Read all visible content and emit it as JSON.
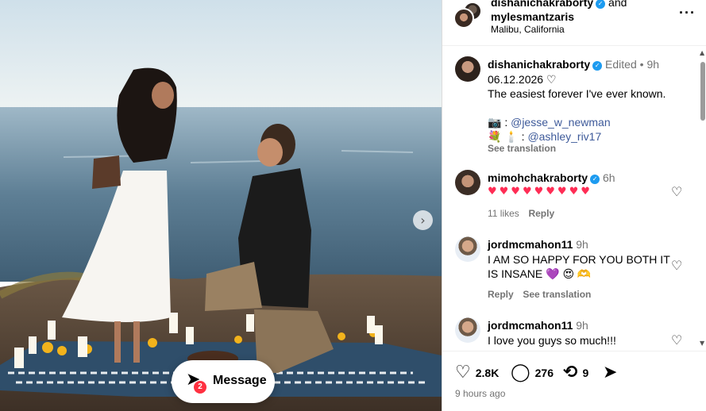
{
  "header": {
    "user1": "dishanichakraborty",
    "and": "and",
    "user2": "mylesmantzaris",
    "location": "Malibu, California"
  },
  "caption": {
    "username": "dishanichakraborty",
    "edited": "Edited",
    "time": "9h",
    "line1": "06.12.2026 ♡",
    "line2": "The easiest forever I've ever known.",
    "credit1_prefix": "📷 :",
    "credit1_handle": "@jesse_w_newman",
    "credit2_prefix": "💐 🕯️ :",
    "credit2_handle": "@ashley_riv17",
    "see_translation": "See translation"
  },
  "comments": [
    {
      "username": "mimohchakraborty",
      "time": "6h",
      "text": "♥♥♥♥♥♥♥♥♥",
      "likes": "11 likes",
      "reply": "Reply"
    },
    {
      "username": "jordmcmahon11",
      "time": "9h",
      "text_line1": "I AM SO HAPPY FOR YOU BOTH IT",
      "text_line2": "IS INSANE 💜 😍 🫶",
      "reply": "Reply",
      "see_translation": "See translation"
    },
    {
      "username": "jordmcmahon11",
      "time": "9h",
      "text": "I love you guys so much!!!"
    }
  ],
  "footer": {
    "likes": "2.8K",
    "comments": "276",
    "reposts": "9",
    "time_ago": "9 hours ago"
  },
  "messages": {
    "label": "Message",
    "badge": "2"
  },
  "icons": {
    "like": "heart-icon",
    "comment": "comment-icon",
    "repost": "repost-icon",
    "share": "send-icon",
    "next": "chevron-right-icon",
    "more": "more-icon"
  }
}
